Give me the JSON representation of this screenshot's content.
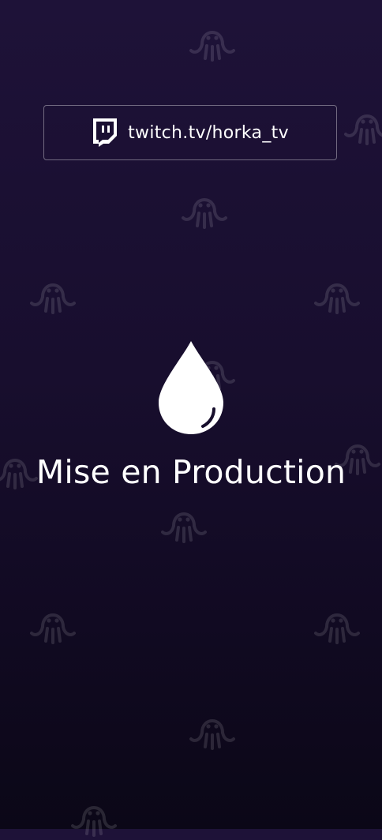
{
  "colors": {
    "background_top": "#1e1238",
    "background_bottom": "#0b0717",
    "text": "#ffffff"
  },
  "link": {
    "icon": "twitch-icon",
    "label": "twitch.tv/horka_tv"
  },
  "hero": {
    "icon": "water-drop-icon",
    "title": "Mise en Production"
  },
  "background_pattern": {
    "icon": "octopus-icon"
  }
}
